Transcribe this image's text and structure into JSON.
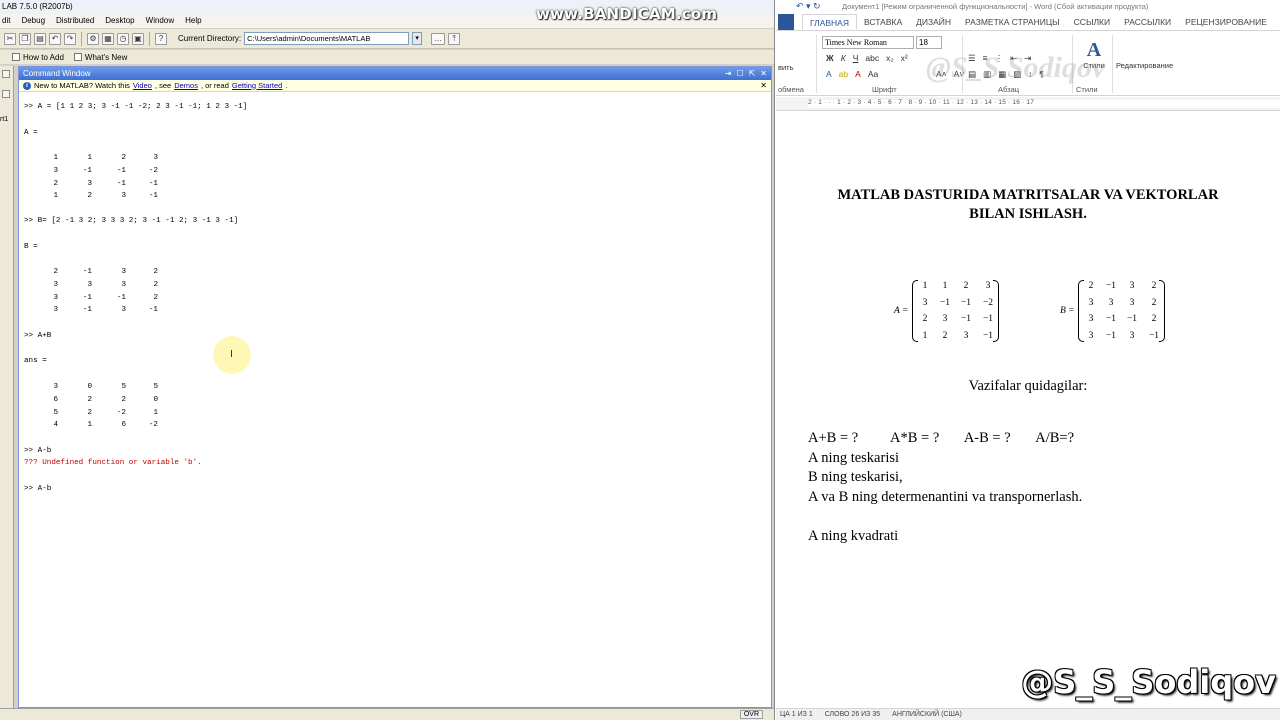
{
  "matlab": {
    "title": "LAB  7.5.0 (R2007b)",
    "menu": [
      "dit",
      "Debug",
      "Distributed",
      "Desktop",
      "Window",
      "Help"
    ],
    "toolbar": {
      "current_dir_label": "Current Directory:",
      "current_dir_value": "C:\\Users\\admin\\Documents\\MATLAB",
      "browse_label": "..."
    },
    "shortcuts": [
      "How to Add",
      "What's New"
    ],
    "left_strip_label": "rt1",
    "command_window": {
      "title": "Command Window",
      "info": {
        "prefix": "New to MATLAB? Watch this",
        "video": "Video",
        "mid": ", see",
        "demos": "Demos",
        "mid2": ", or read",
        "getting_started": "Getting Started",
        "suffix": "."
      },
      "cmd_A": ">> A = [1 1 2 3; 3 -1 -1 -2; 2 3 -1 -1; 1 2 3 -1]",
      "label_A": "A =",
      "matrix_A": [
        [
          "1",
          "1",
          "2",
          "3"
        ],
        [
          "3",
          "-1",
          "-1",
          "-2"
        ],
        [
          "2",
          "3",
          "-1",
          "-1"
        ],
        [
          "1",
          "2",
          "3",
          "-1"
        ]
      ],
      "cmd_B": ">> B= [2 -1 3 2; 3 3 3 2; 3 -1 -1 2; 3 -1 3 -1]",
      "label_B": "B =",
      "matrix_B": [
        [
          "2",
          "-1",
          "3",
          "2"
        ],
        [
          "3",
          "3",
          "3",
          "2"
        ],
        [
          "3",
          "-1",
          "-1",
          "2"
        ],
        [
          "3",
          "-1",
          "3",
          "-1"
        ]
      ],
      "cmd_sum": ">> A+B",
      "label_ans": "ans =",
      "matrix_ans": [
        [
          "3",
          "0",
          "5",
          "5"
        ],
        [
          "6",
          "2",
          "2",
          "0"
        ],
        [
          "5",
          "2",
          "-2",
          "1"
        ],
        [
          "4",
          "1",
          "6",
          "-2"
        ]
      ],
      "cmd_err": ">> A-b",
      "error_msg": "??? Undefined function or variable 'b'.",
      "cmd_last": ">> A-b"
    },
    "status": {
      "ovr": "OVR"
    }
  },
  "recorder_watermark": "www.BANDICAM.com",
  "word": {
    "title": "Документ1 [Режим ограниченной функциональности] - Word (Сбой активации продукта)",
    "tabs": [
      "ГЛАВНАЯ",
      "ВСТАВКА",
      "ДИЗАЙН",
      "РАЗМЕТКА СТРАНИЦЫ",
      "ССЫЛКИ",
      "РАССЫЛКИ",
      "РЕЦЕНЗИРОВАНИЕ"
    ],
    "active_tab": "ГЛАВНАЯ",
    "ribbon": {
      "font_name": "Times New Roman",
      "font_size": "18",
      "groups": [
        "обмена",
        "Шрифт",
        "Абзац",
        "Стили"
      ],
      "styles_label": "Стили",
      "editing_label": "Редактирование",
      "paste_label": "вить",
      "watermark": "@S_S Sodiqov"
    },
    "ruler": "2 · 1 · · · 1 · 2 · 3 · 4 · 5 · 6 · 7 · 8 · 9 · 10 · 11 · 12 · 13 · 14 · 15 · 16 · 17",
    "document": {
      "title": "MATLAB DASTURIDA MATRITSALAR VA VEKTORLAR BILAN ISHLASH.",
      "matrix_A_name": "A =",
      "matrix_A": [
        [
          "1",
          "1",
          "2",
          "3"
        ],
        [
          "3",
          "−1",
          "−1",
          "−2"
        ],
        [
          "2",
          "3",
          "−1",
          "−1"
        ],
        [
          "1",
          "2",
          "3",
          "−1"
        ]
      ],
      "matrix_B_name": "B =",
      "matrix_B": [
        [
          "2",
          "−1",
          "3",
          "2"
        ],
        [
          "3",
          "3",
          "3",
          "2"
        ],
        [
          "3",
          "−1",
          "−1",
          "2"
        ],
        [
          "3",
          "−1",
          "3",
          "−1"
        ]
      ],
      "tasks_heading": "Vazifalar quidagilar:",
      "task_ops": "A+B = ?         A*B = ?       A-B = ?       A/B=?",
      "task_lines": [
        "A ning teskarisi",
        "B ning teskarisi,",
        "A va B ning determenantini va transpornerlash.",
        "",
        "A ning kvadrati"
      ]
    },
    "status": [
      "ЦА 1 ИЗ 1",
      "СЛОВО 26 ИЗ 35",
      "АНГЛИЙСКИЙ (США)"
    ],
    "handle_watermark": "@S_S_Sodiqov"
  }
}
